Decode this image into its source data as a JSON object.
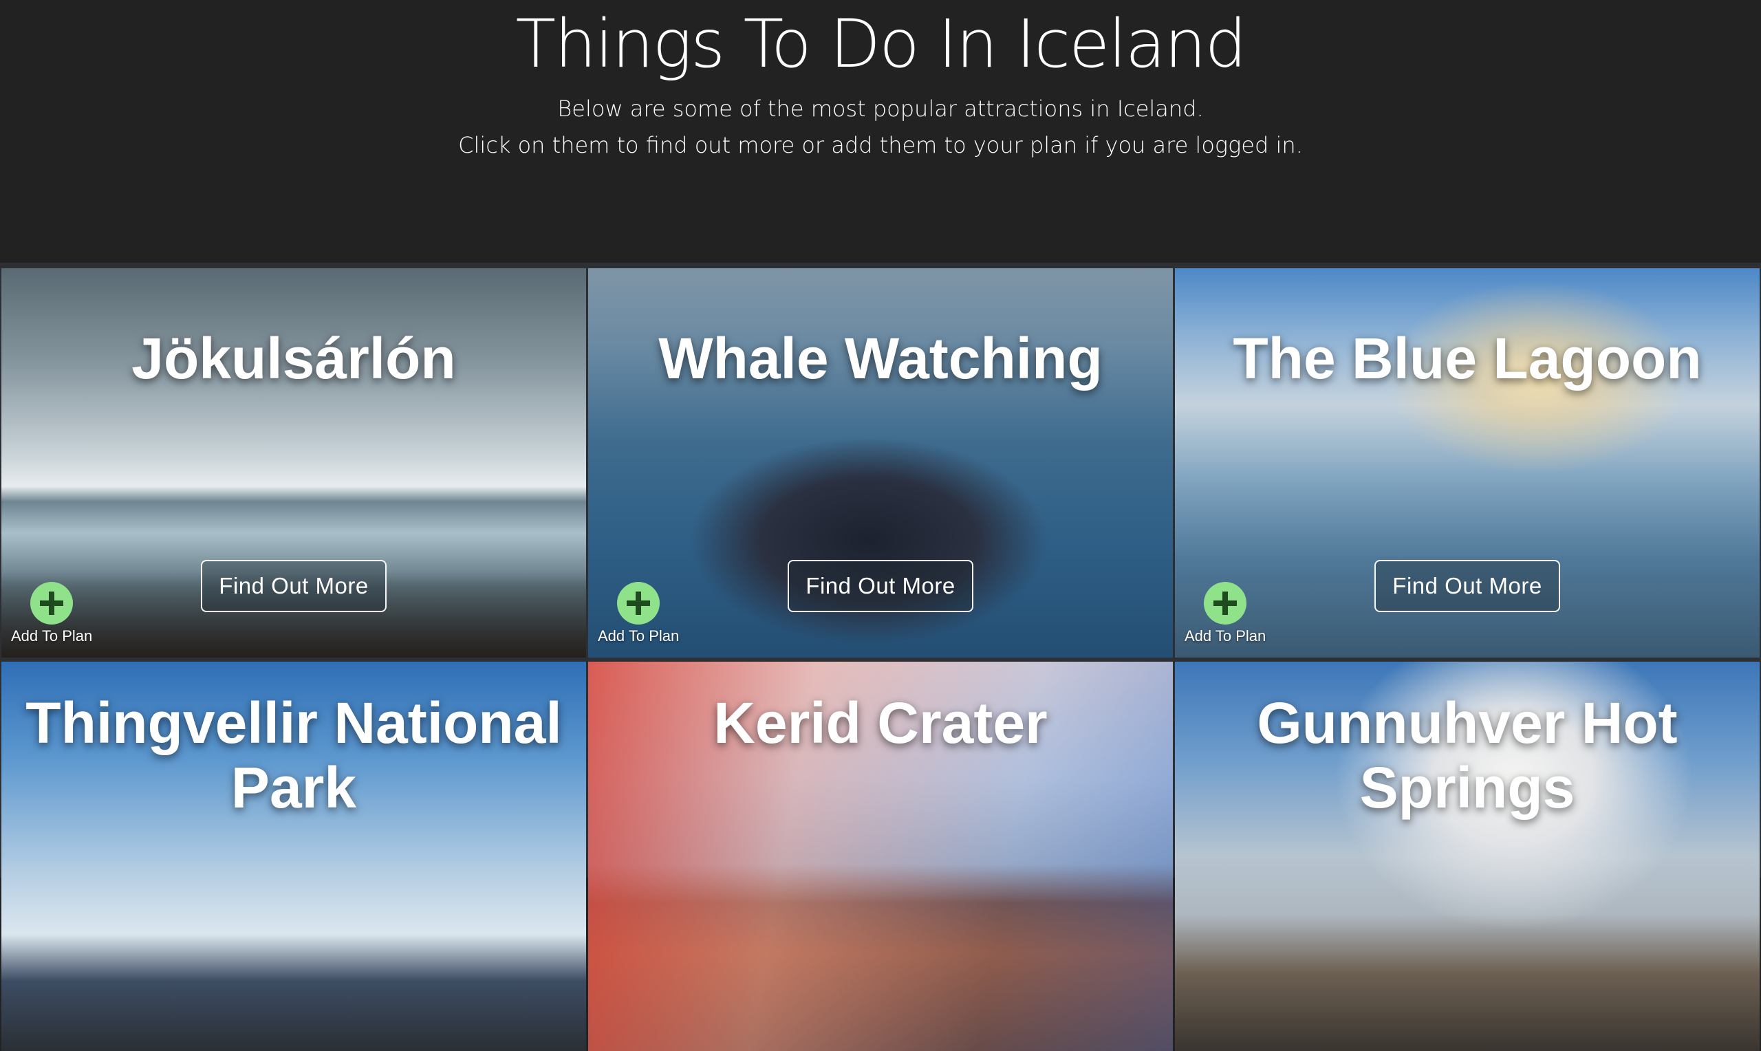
{
  "header": {
    "title": "Things To Do In Iceland",
    "subtitle_line1": "Below are some of the most popular attractions in Iceland.",
    "subtitle_line2": "Click on them to find out more or add them to your plan if you are logged in."
  },
  "attractions": [
    {
      "title": "Jökulsárlón",
      "find_out_more": "Find Out More",
      "add_to_plan": "Add To Plan",
      "add_icon": "plus-circle-icon"
    },
    {
      "title": "Whale Watching",
      "find_out_more": "Find Out More",
      "add_to_plan": "Add To Plan",
      "add_icon": "plus-circle-icon"
    },
    {
      "title": "The Blue Lagoon",
      "find_out_more": "Find Out More",
      "add_to_plan": "Add To Plan",
      "add_icon": "plus-circle-icon"
    },
    {
      "title": "Thingvellir National Park"
    },
    {
      "title": "Kerid Crater"
    },
    {
      "title": "Gunnuhver Hot Springs"
    }
  ],
  "colors": {
    "header_bg": "#222222",
    "add_button": "#8fe28a",
    "add_button_icon": "#1f4a1f"
  }
}
